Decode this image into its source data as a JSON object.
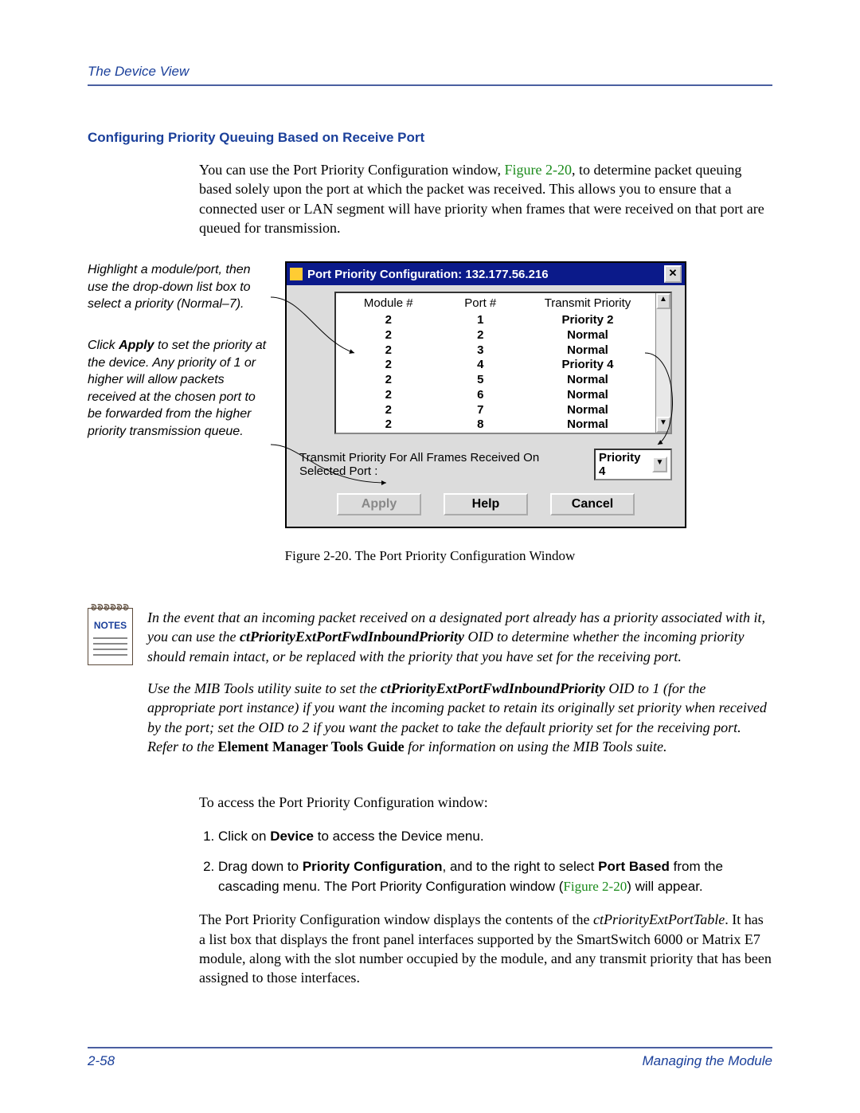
{
  "header": {
    "title": "The Device View"
  },
  "section": {
    "heading": "Configuring Priority Queuing Based on Receive Port"
  },
  "intro": {
    "pre": "You can use the Port Priority Configuration window, ",
    "figref": "Figure 2-20",
    "post": ", to determine packet queuing based solely upon the port at which the packet was received. This allows you to ensure that a connected user or LAN segment will have priority when frames that were received on that port are queued for transmission."
  },
  "annotations": {
    "a1": "Highlight a module/port, then use the drop-down list box to select a priority (Normal–7).",
    "a2_pre": "Click ",
    "a2_bold": "Apply",
    "a2_post": " to set the priority at the device. Any priority of 1 or higher will allow packets received at the chosen port to be forwarded from the higher priority transmission queue."
  },
  "window": {
    "title": "Port Priority Configuration: 132.177.56.216",
    "headers": {
      "c1": "Module #",
      "c2": "Port #",
      "c3": "Transmit Priority"
    },
    "rows": [
      {
        "m": "2",
        "p": "1",
        "t": "Priority 2"
      },
      {
        "m": "2",
        "p": "2",
        "t": "Normal"
      },
      {
        "m": "2",
        "p": "3",
        "t": "Normal"
      },
      {
        "m": "2",
        "p": "4",
        "t": "Priority 4"
      },
      {
        "m": "2",
        "p": "5",
        "t": "Normal"
      },
      {
        "m": "2",
        "p": "6",
        "t": "Normal"
      },
      {
        "m": "2",
        "p": "7",
        "t": "Normal"
      },
      {
        "m": "2",
        "p": "8",
        "t": "Normal"
      }
    ],
    "mid_label": "Transmit Priority For All Frames Received On Selected Port :",
    "combo_value": "Priority 4",
    "buttons": {
      "apply": "Apply",
      "help": "Help",
      "cancel": "Cancel"
    }
  },
  "caption": "Figure 2-20. The Port Priority Configuration Window",
  "notes": {
    "label": "NOTES",
    "p1_a": "In the event that an incoming packet received on a designated port already has a priority associated with it, you can use the ",
    "p1_b": "ctPriorityExtPortFwdInboundPriority",
    "p1_c": " OID to determine whether the incoming priority should remain intact, or be replaced with the priority that you have set for the receiving port.",
    "p2_a": "Use the MIB Tools utility suite to set the ",
    "p2_b": "ctPriorityExtPortFwdInboundPriority",
    "p2_c": " OID to 1 (for the appropriate port instance) if you want the incoming packet to retain its originally set priority when received by the port; set the OID to 2 if you want the packet to take the default priority set for the receiving port. Refer to the ",
    "p2_d": "Element Manager Tools Guide",
    "p2_e": " for information on using the MIB Tools suite."
  },
  "access_line": "To access the Port Priority Configuration window:",
  "steps": {
    "s1_a": "Click on ",
    "s1_b": "Device",
    "s1_c": " to access the Device menu.",
    "s2_a": "Drag down to ",
    "s2_b": "Priority Configuration",
    "s2_c": ", and to the right to select ",
    "s2_d": "Port Based",
    "s2_e": " from the cascading menu. The Port Priority Configuration window (",
    "s2_f": "Figure 2-20",
    "s2_g": ") will appear."
  },
  "trailing": {
    "a": "The Port Priority Configuration window displays the contents of the ",
    "b": "ctPriorityExtPortTable",
    "c": ". It has a list box that displays the front panel interfaces supported by the SmartSwitch 6000 or Matrix E7 module, along with the slot number occupied by the module, and any transmit priority that has been assigned to those interfaces."
  },
  "footer": {
    "left": "2-58",
    "right": "Managing the Module"
  }
}
